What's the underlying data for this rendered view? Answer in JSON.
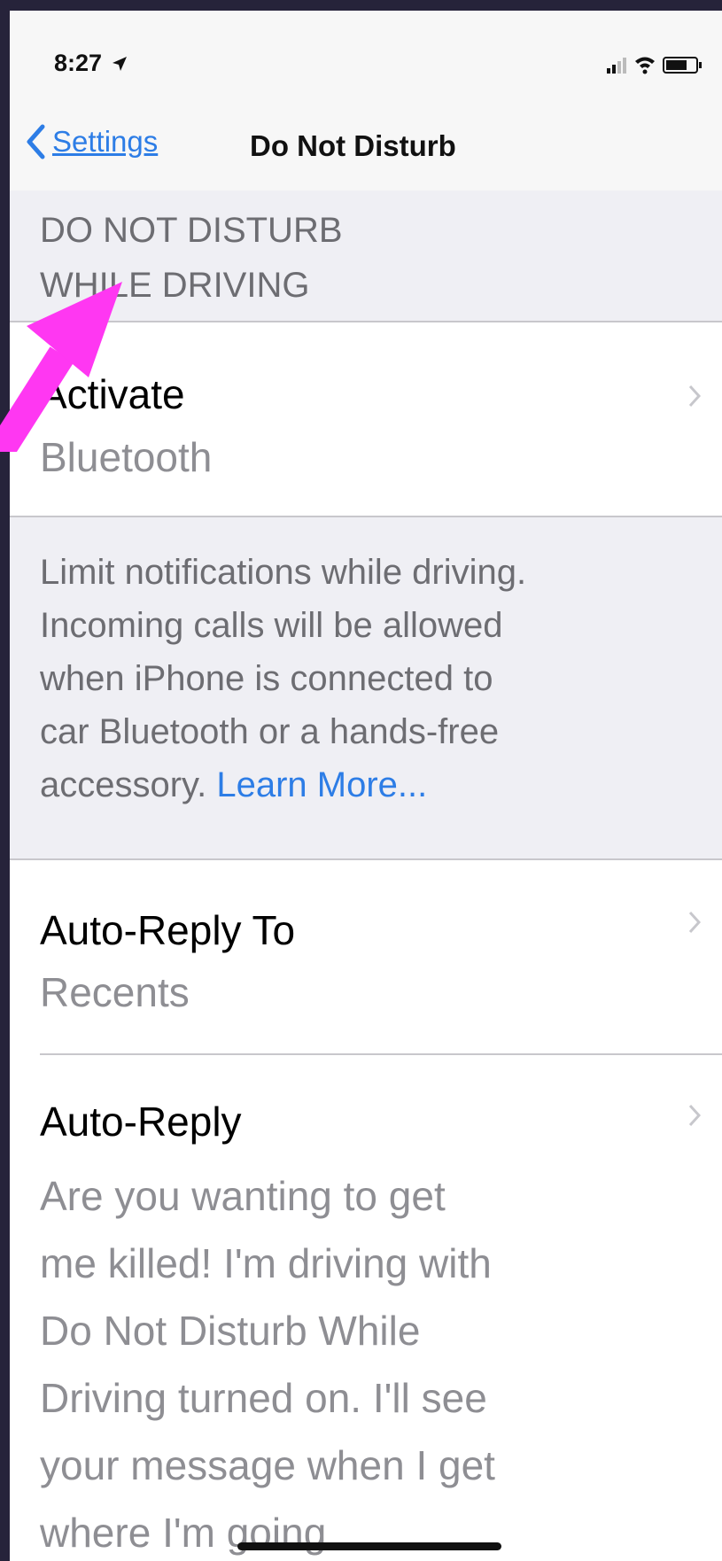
{
  "status_bar": {
    "time": "8:27",
    "icons": [
      "location-arrow-icon",
      "signal-icon",
      "wifi-icon",
      "battery-icon"
    ]
  },
  "nav": {
    "back_label": "Settings",
    "title": "Do Not Disturb"
  },
  "section": {
    "header_line1": "DO NOT DISTURB",
    "header_line2": "WHILE DRIVING"
  },
  "activate": {
    "title": "Activate",
    "value": "Bluetooth"
  },
  "footer": {
    "lines": [
      "Limit notifications while driving.",
      "Incoming calls will be allowed",
      "when iPhone is connected to",
      "car Bluetooth or a hands-free"
    ],
    "last_line_prefix": "accessory.",
    "learn_more": "Learn More..."
  },
  "auto_reply_to": {
    "title": "Auto-Reply To",
    "value": "Recents"
  },
  "auto_reply": {
    "title": "Auto-Reply",
    "lines": [
      "Are you wanting to get",
      "me killed! I'm driving with",
      "Do Not Disturb While",
      "Driving turned on. I'll see",
      "your message when I get",
      "where I'm going."
    ]
  },
  "colors": {
    "accent": "#2d7de6",
    "annotation_arrow": "#ff37f2",
    "secondary_text": "#8e8e93"
  }
}
